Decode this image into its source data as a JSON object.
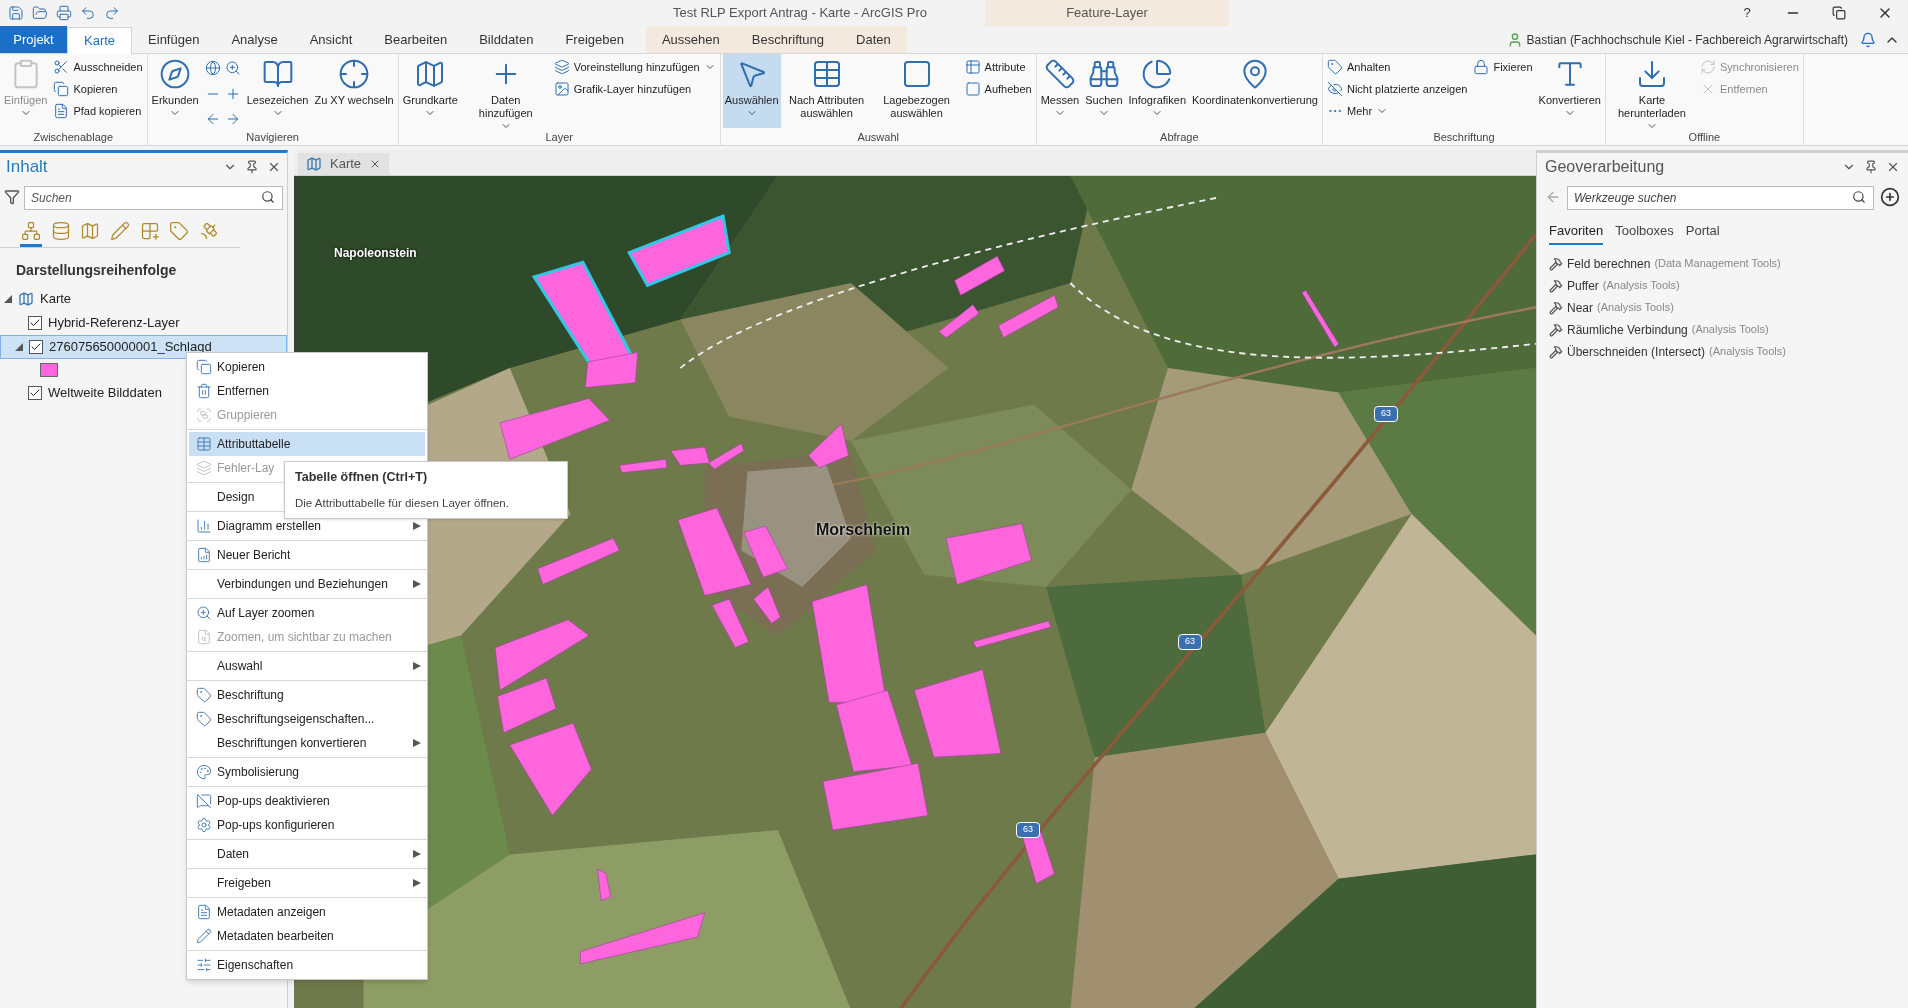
{
  "title_bar": {
    "title": "Test RLP Export Antrag - Karte - ArcGIS Pro",
    "context_group": "Feature-Layer",
    "help": "?"
  },
  "tabs": [
    {
      "label": "Projekt",
      "kind": "project",
      "selected": false
    },
    {
      "label": "Karte",
      "kind": "normal",
      "selected": true
    },
    {
      "label": "Einfügen",
      "kind": "normal",
      "selected": false
    },
    {
      "label": "Analyse",
      "kind": "normal",
      "selected": false
    },
    {
      "label": "Ansicht",
      "kind": "normal",
      "selected": false
    },
    {
      "label": "Bearbeiten",
      "kind": "normal",
      "selected": false
    },
    {
      "label": "Bilddaten",
      "kind": "normal",
      "selected": false
    },
    {
      "label": "Freigeben",
      "kind": "normal",
      "selected": false
    },
    {
      "label": "Aussehen",
      "kind": "contextual",
      "selected": false
    },
    {
      "label": "Beschriftung",
      "kind": "contextual",
      "selected": false
    },
    {
      "label": "Daten",
      "kind": "contextual",
      "selected": false
    }
  ],
  "user": "Bastian (Fachhochschule Kiel - Fachbereich Agrarwirtschaft)",
  "ribbon": [
    {
      "label": "Zwischenablage",
      "columns": [
        {
          "kind": "large",
          "items": [
            {
              "label": "Einfügen",
              "disabled": true,
              "dropdown": true
            }
          ]
        },
        {
          "kind": "small",
          "items": [
            {
              "label": "Ausschneiden",
              "disabled": false
            },
            {
              "label": "Kopieren",
              "disabled": false
            },
            {
              "label": "Pfad kopieren",
              "disabled": false
            }
          ]
        }
      ]
    },
    {
      "label": "Navigieren",
      "columns": [
        {
          "kind": "large",
          "items": [
            {
              "label": "Erkunden",
              "disabled": false,
              "dropdown": true
            }
          ]
        },
        {
          "kind": "nav"
        },
        {
          "kind": "large",
          "items": [
            {
              "label": "Lesezeichen",
              "disabled": false,
              "dropdown": true
            }
          ]
        },
        {
          "kind": "large",
          "items": [
            {
              "label": "Zu XY wechseln",
              "disabled": false,
              "dropdown": false
            }
          ]
        }
      ]
    },
    {
      "label": "Layer",
      "columns": [
        {
          "kind": "large",
          "items": [
            {
              "label": "Grundkarte",
              "disabled": false,
              "dropdown": true
            }
          ]
        },
        {
          "kind": "large",
          "items": [
            {
              "label": "Daten hinzufügen",
              "disabled": false,
              "dropdown": true
            }
          ]
        },
        {
          "kind": "small",
          "items": [
            {
              "label": "Voreinstellung hinzufügen",
              "disabled": false,
              "dropdown": true
            },
            {
              "label": "Grafik-Layer hinzufügen",
              "disabled": false
            }
          ]
        }
      ]
    },
    {
      "label": "Auswahl",
      "columns": [
        {
          "kind": "large",
          "items": [
            {
              "label": "Auswählen",
              "disabled": false,
              "dropdown": true,
              "selected": true
            }
          ]
        },
        {
          "kind": "large",
          "items": [
            {
              "label": "Nach Attributen auswählen",
              "disabled": false,
              "selected": false
            }
          ]
        },
        {
          "kind": "large",
          "items": [
            {
              "label": "Lagebezogen auswählen",
              "disabled": false,
              "selected": false
            }
          ]
        },
        {
          "kind": "small",
          "items": [
            {
              "label": "Attribute",
              "disabled": false
            },
            {
              "label": "Aufheben",
              "disabled": false
            }
          ]
        }
      ]
    },
    {
      "label": "Abfrage",
      "columns": [
        {
          "kind": "large",
          "items": [
            {
              "label": "Messen",
              "disabled": false,
              "dropdown": true
            }
          ]
        },
        {
          "kind": "large",
          "items": [
            {
              "label": "Suchen",
              "disabled": false,
              "dropdown": true
            }
          ]
        },
        {
          "kind": "large",
          "items": [
            {
              "label": "Infografiken",
              "disabled": false,
              "dropdown": true
            }
          ]
        },
        {
          "kind": "large",
          "items": [
            {
              "label": "Koordinatenkonvertierung",
              "disabled": false
            }
          ]
        }
      ]
    },
    {
      "label": "Beschriftung",
      "columns": [
        {
          "kind": "small",
          "items": [
            {
              "label": "Anhalten",
              "disabled": false
            },
            {
              "label": "Nicht platzierte anzeigen",
              "disabled": false
            },
            {
              "label": "Mehr",
              "disabled": false,
              "dropdown": true
            }
          ]
        },
        {
          "kind": "small",
          "items": [
            {
              "label": "Fixieren",
              "disabled": false
            }
          ]
        },
        {
          "kind": "large",
          "items": [
            {
              "label": "Konvertieren",
              "disabled": false,
              "dropdown": true
            }
          ]
        }
      ]
    },
    {
      "label": "Offline",
      "columns": [
        {
          "kind": "large",
          "items": [
            {
              "label": "Karte herunterladen",
              "disabled": false,
              "dropdown": true
            }
          ]
        },
        {
          "kind": "small",
          "items": [
            {
              "label": "Synchronisieren",
              "disabled": true
            },
            {
              "label": "Entfernen",
              "disabled": true
            }
          ]
        }
      ]
    }
  ],
  "contents": {
    "title": "Inhalt",
    "search_placeholder": "Suchen",
    "view_tabs": [
      {
        "selected": true
      },
      {
        "selected": false
      },
      {
        "selected": false
      },
      {
        "selected": false
      },
      {
        "selected": false
      },
      {
        "selected": false
      },
      {
        "selected": false
      }
    ],
    "heading": "Darstellungsreihenfolge",
    "tree": [
      {
        "label": "Karte",
        "kind": "map",
        "expanded": true,
        "children": [
          {
            "label": "Hybrid-Referenz-Layer",
            "kind": "layer",
            "checked": true,
            "selected": false
          },
          {
            "label": "276075650000001_Schlagd",
            "kind": "layer",
            "checked": true,
            "selected": true,
            "expanded": true,
            "children": [
              {
                "kind": "swatch",
                "color": "#ff66dd"
              }
            ]
          },
          {
            "label": "Weltweite Bilddaten",
            "kind": "layer",
            "checked": true,
            "selected": false
          }
        ]
      }
    ]
  },
  "map_view": {
    "tab": "Karte",
    "labels": [
      {
        "text": "Napoleonstein",
        "kind": "place"
      },
      {
        "text": "Morschheim",
        "kind": "town"
      },
      {
        "text": "63",
        "kind": "shield"
      },
      {
        "text": "63",
        "kind": "shield"
      },
      {
        "text": "63",
        "kind": "shield"
      }
    ]
  },
  "context_menu": [
    [
      {
        "label": "Kopieren",
        "disabled": false,
        "submenu": false,
        "selected": false
      },
      {
        "label": "Entfernen",
        "disabled": false,
        "submenu": false,
        "selected": false
      },
      {
        "label": "Gruppieren",
        "disabled": true,
        "submenu": false,
        "selected": false
      }
    ],
    [
      {
        "label": "Attributtabelle",
        "disabled": false,
        "submenu": false,
        "selected": true
      },
      {
        "label": "Fehler-Lay",
        "disabled": true,
        "selected": false
      }
    ],
    [
      {
        "label": "Design",
        "disabled": false,
        "selected": false
      }
    ],
    [
      {
        "label": "Diagramm erstellen",
        "disabled": false,
        "submenu": true,
        "selected": false
      }
    ],
    [
      {
        "label": "Neuer Bericht",
        "disabled": false,
        "submenu": false,
        "selected": false
      }
    ],
    [
      {
        "label": "Verbindungen und Beziehungen",
        "disabled": false,
        "submenu": true,
        "selected": false
      }
    ],
    [
      {
        "label": "Auf Layer zoomen",
        "disabled": false,
        "submenu": false,
        "selected": false
      },
      {
        "label": "Zoomen, um sichtbar zu machen",
        "disabled": true,
        "submenu": false,
        "selected": false
      }
    ],
    [
      {
        "label": "Auswahl",
        "disabled": false,
        "submenu": true,
        "selected": false
      }
    ],
    [
      {
        "label": "Beschriftung",
        "disabled": false,
        "submenu": false,
        "selected": false
      },
      {
        "label": "Beschriftungseigenschaften...",
        "disabled": false,
        "submenu": false,
        "selected": false
      },
      {
        "label": "Beschriftungen konvertieren",
        "disabled": false,
        "submenu": true,
        "selected": false
      }
    ],
    [
      {
        "label": "Symbolisierung",
        "disabled": false,
        "submenu": false,
        "selected": false
      }
    ],
    [
      {
        "label": "Pop-ups deaktivieren",
        "disabled": false,
        "submenu": false,
        "selected": false
      },
      {
        "label": "Pop-ups konfigurieren",
        "disabled": false,
        "submenu": false,
        "selected": false
      }
    ],
    [
      {
        "label": "Daten",
        "disabled": false,
        "submenu": true,
        "selected": false
      }
    ],
    [
      {
        "label": "Freigeben",
        "disabled": false,
        "submenu": true,
        "selected": false
      }
    ],
    [
      {
        "label": "Metadaten anzeigen",
        "disabled": false,
        "submenu": false,
        "selected": false
      },
      {
        "label": "Metadaten bearbeiten",
        "disabled": false,
        "submenu": false,
        "selected": false
      }
    ],
    [
      {
        "label": "Eigenschaften",
        "disabled": false,
        "submenu": false,
        "selected": false
      }
    ]
  ],
  "tooltip": {
    "title": "Tabelle öffnen (Ctrl+T)",
    "text": "Die Attributtabelle für diesen Layer öffnen."
  },
  "geoprocessing": {
    "title": "Geoverarbeitung",
    "search_placeholder": "Werkzeuge suchen",
    "tabs": [
      {
        "label": "Favoriten",
        "selected": true
      },
      {
        "label": "Toolboxes",
        "selected": false
      },
      {
        "label": "Portal",
        "selected": false
      }
    ],
    "tools": [
      {
        "name": "Feld berechnen",
        "toolbox": "(Data Management Tools)"
      },
      {
        "name": "Puffer",
        "toolbox": "(Analysis Tools)"
      },
      {
        "name": "Near",
        "toolbox": "(Analysis Tools)"
      },
      {
        "name": "Räumliche Verbindung",
        "toolbox": "(Analysis Tools)"
      },
      {
        "name": "Überschneiden (Intersect)",
        "toolbox": "(Analysis Tools)"
      }
    ]
  }
}
